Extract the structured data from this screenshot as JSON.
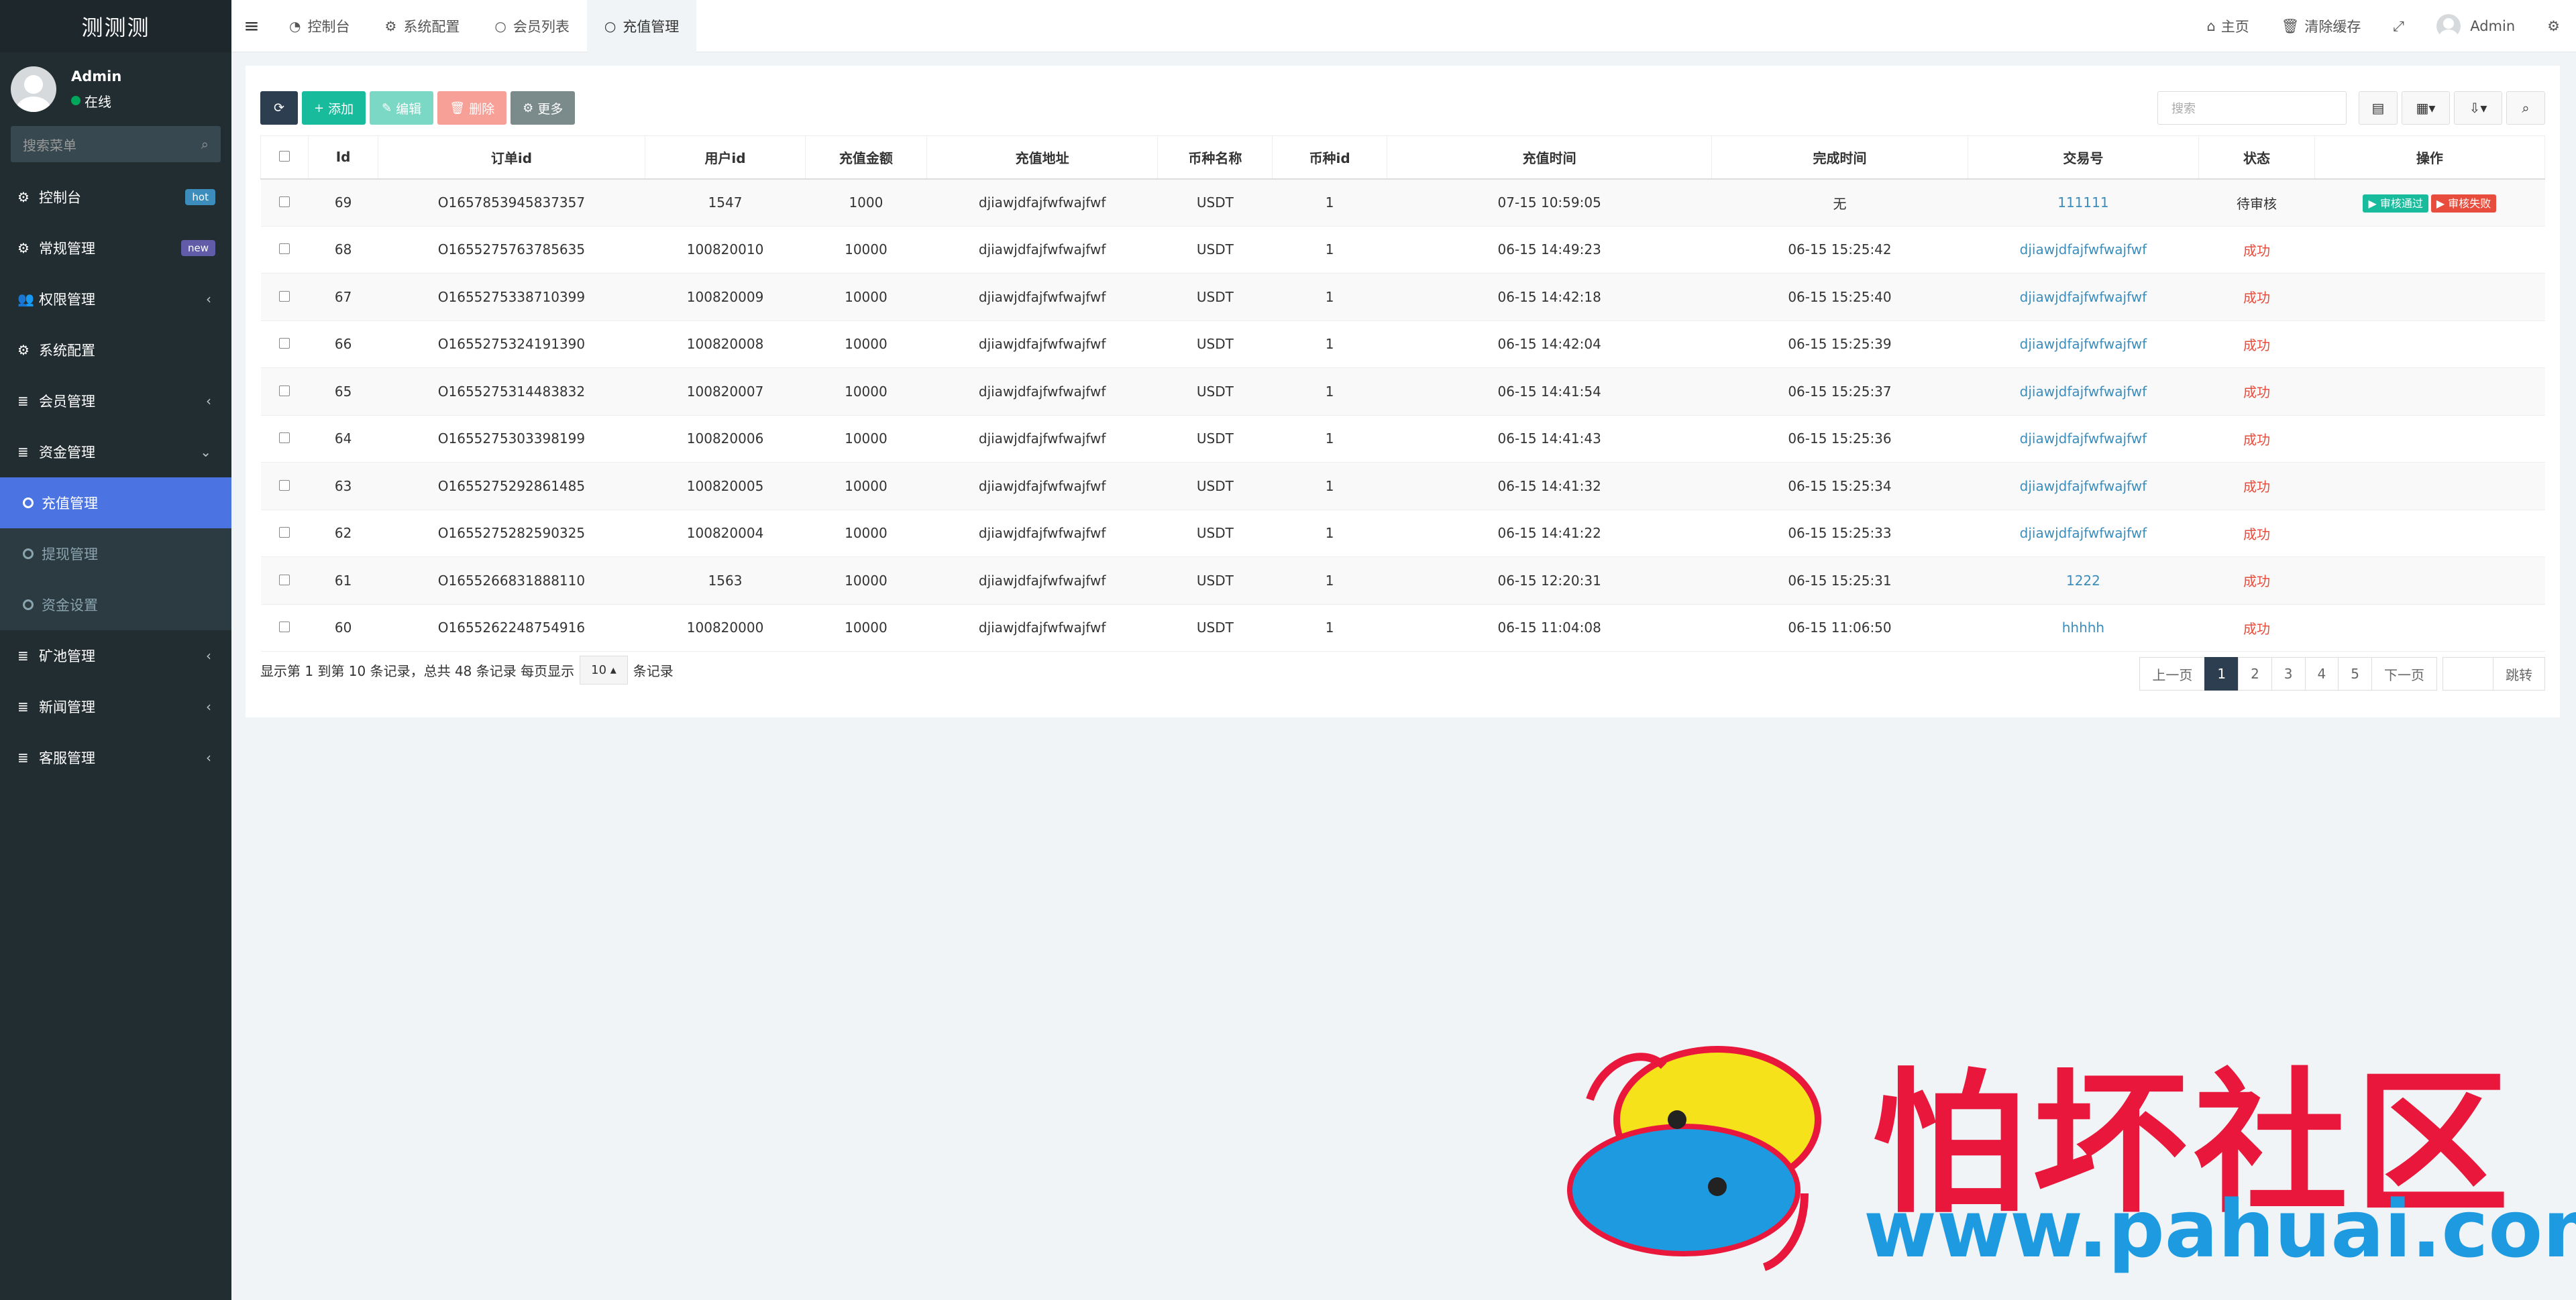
{
  "app": {
    "title": "测测测",
    "user_name": "Admin",
    "user_status": "在线",
    "search_placeholder": "搜索菜单"
  },
  "sidebar": {
    "items": [
      {
        "icon": "dashboard-icon",
        "glyph": "⚙",
        "label": "控制台",
        "badge": "hot",
        "badge_color": "#3c8dbc"
      },
      {
        "icon": "cogs-icon",
        "glyph": "⚙",
        "label": "常规管理",
        "badge": "new",
        "badge_color": "#605ca8"
      },
      {
        "icon": "users-icon",
        "glyph": "👥",
        "label": "权限管理",
        "chevron": "‹"
      },
      {
        "icon": "gear-icon",
        "glyph": "⚙",
        "label": "系统配置"
      },
      {
        "icon": "list-icon",
        "glyph": "≣",
        "label": "会员管理",
        "chevron": "‹"
      },
      {
        "icon": "list-icon",
        "glyph": "≣",
        "label": "资金管理",
        "chevron": "⌄"
      }
    ],
    "sub_items": [
      {
        "label": "充值管理",
        "active": true
      },
      {
        "label": "提现管理"
      },
      {
        "label": "资金设置"
      }
    ],
    "items_after": [
      {
        "icon": "list-icon",
        "glyph": "≣",
        "label": "矿池管理",
        "chevron": "‹"
      },
      {
        "icon": "list-icon",
        "glyph": "≣",
        "label": "新闻管理",
        "chevron": "‹"
      },
      {
        "icon": "list-icon",
        "glyph": "≣",
        "label": "客服管理",
        "chevron": "‹"
      }
    ]
  },
  "topbar": {
    "tabs": [
      {
        "label": "控制台",
        "icon": "dashboard-icon"
      },
      {
        "label": "系统配置",
        "icon": "gear-icon"
      },
      {
        "label": "会员列表",
        "icon": "circle-icon"
      },
      {
        "label": "充值管理",
        "icon": "circle-icon",
        "active": true
      }
    ],
    "home": "主页",
    "clear_cache": "清除缓存",
    "admin": "Admin"
  },
  "toolbar": {
    "add": "添加",
    "edit": "编辑",
    "delete": "删除",
    "more": "更多",
    "search_placeholder": "搜索"
  },
  "table": {
    "columns": [
      "Id",
      "订单id",
      "用户id",
      "充值金额",
      "充值地址",
      "币种名称",
      "币种id",
      "充值时间",
      "完成时间",
      "交易号",
      "状态",
      "操作"
    ],
    "rows": [
      {
        "id": "69",
        "order": "O1657853945837357",
        "uid": "1547",
        "amount": "1000",
        "addr": "djiawjdfajfwfwajfwf",
        "coin": "USDT",
        "coin_id": "1",
        "t1": "07-15 10:59:05",
        "t2": "无",
        "tx": "111111",
        "status": "待审核",
        "pending": true
      },
      {
        "id": "68",
        "order": "O1655275763785635",
        "uid": "100820010",
        "amount": "10000",
        "addr": "djiawjdfajfwfwajfwf",
        "coin": "USDT",
        "coin_id": "1",
        "t1": "06-15 14:49:23",
        "t2": "06-15 15:25:42",
        "tx": "djiawjdfajfwfwajfwf",
        "status": "成功"
      },
      {
        "id": "67",
        "order": "O1655275338710399",
        "uid": "100820009",
        "amount": "10000",
        "addr": "djiawjdfajfwfwajfwf",
        "coin": "USDT",
        "coin_id": "1",
        "t1": "06-15 14:42:18",
        "t2": "06-15 15:25:40",
        "tx": "djiawjdfajfwfwajfwf",
        "status": "成功"
      },
      {
        "id": "66",
        "order": "O1655275324191390",
        "uid": "100820008",
        "amount": "10000",
        "addr": "djiawjdfajfwfwajfwf",
        "coin": "USDT",
        "coin_id": "1",
        "t1": "06-15 14:42:04",
        "t2": "06-15 15:25:39",
        "tx": "djiawjdfajfwfwajfwf",
        "status": "成功"
      },
      {
        "id": "65",
        "order": "O1655275314483832",
        "uid": "100820007",
        "amount": "10000",
        "addr": "djiawjdfajfwfwajfwf",
        "coin": "USDT",
        "coin_id": "1",
        "t1": "06-15 14:41:54",
        "t2": "06-15 15:25:37",
        "tx": "djiawjdfajfwfwajfwf",
        "status": "成功"
      },
      {
        "id": "64",
        "order": "O1655275303398199",
        "uid": "100820006",
        "amount": "10000",
        "addr": "djiawjdfajfwfwajfwf",
        "coin": "USDT",
        "coin_id": "1",
        "t1": "06-15 14:41:43",
        "t2": "06-15 15:25:36",
        "tx": "djiawjdfajfwfwajfwf",
        "status": "成功"
      },
      {
        "id": "63",
        "order": "O1655275292861485",
        "uid": "100820005",
        "amount": "10000",
        "addr": "djiawjdfajfwfwajfwf",
        "coin": "USDT",
        "coin_id": "1",
        "t1": "06-15 14:41:32",
        "t2": "06-15 15:25:34",
        "tx": "djiawjdfajfwfwajfwf",
        "status": "成功"
      },
      {
        "id": "62",
        "order": "O1655275282590325",
        "uid": "100820004",
        "amount": "10000",
        "addr": "djiawjdfajfwfwajfwf",
        "coin": "USDT",
        "coin_id": "1",
        "t1": "06-15 14:41:22",
        "t2": "06-15 15:25:33",
        "tx": "djiawjdfajfwfwajfwf",
        "status": "成功"
      },
      {
        "id": "61",
        "order": "O1655266831888110",
        "uid": "1563",
        "amount": "10000",
        "addr": "djiawjdfajfwfwajfwf",
        "coin": "USDT",
        "coin_id": "1",
        "t1": "06-15 12:20:31",
        "t2": "06-15 15:25:31",
        "tx": "1222",
        "status": "成功"
      },
      {
        "id": "60",
        "order": "O1655262248754916",
        "uid": "100820000",
        "amount": "10000",
        "addr": "djiawjdfajfwfwajfwf",
        "coin": "USDT",
        "coin_id": "1",
        "t1": "06-15 11:04:08",
        "t2": "06-15 11:06:50",
        "tx": "hhhhh",
        "status": "成功"
      }
    ],
    "op_pass": "审核通过",
    "op_fail": "审核失败"
  },
  "pager": {
    "info": "显示第 1 到第 10 条记录，总共 48 条记录 每页显示",
    "size": "10",
    "suffix": "条记录",
    "prev": "上一页",
    "pages": [
      "1",
      "2",
      "3",
      "4",
      "5"
    ],
    "next": "下一页",
    "jump": "跳转"
  },
  "watermark": {
    "text": "怕坏社区",
    "url": "www.pahuai.com"
  }
}
